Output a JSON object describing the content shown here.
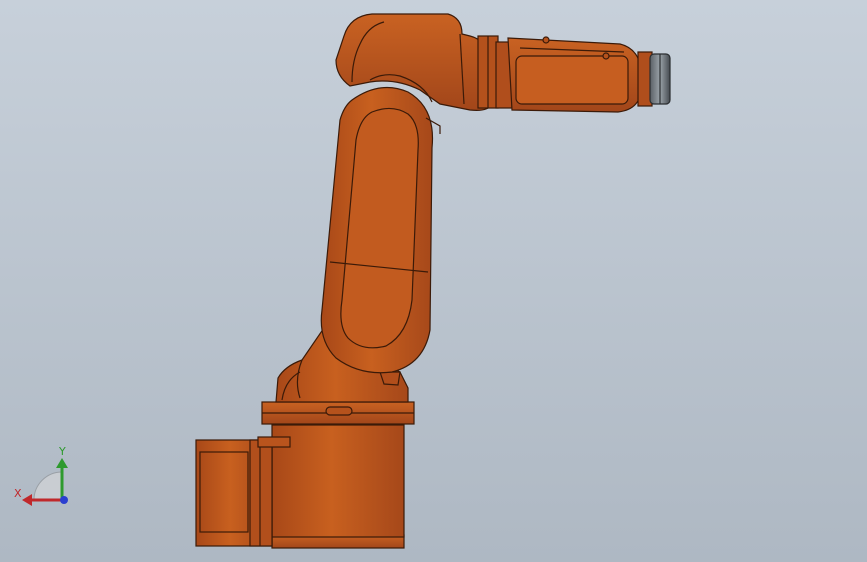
{
  "viewport": {
    "background_top": "#c7d0da",
    "background_bottom": "#aeb8c3"
  },
  "model": {
    "body_color": "#c45a1f",
    "body_dark": "#8a3a10",
    "body_light": "#e0824a",
    "flange_color": "#4a4f55",
    "flange_light": "#8a9196"
  },
  "triad": {
    "x_label": "X",
    "y_label": "Y",
    "x_color": "#c0282b",
    "y_color": "#2e9a2e",
    "z_color": "#2a3fd0"
  }
}
